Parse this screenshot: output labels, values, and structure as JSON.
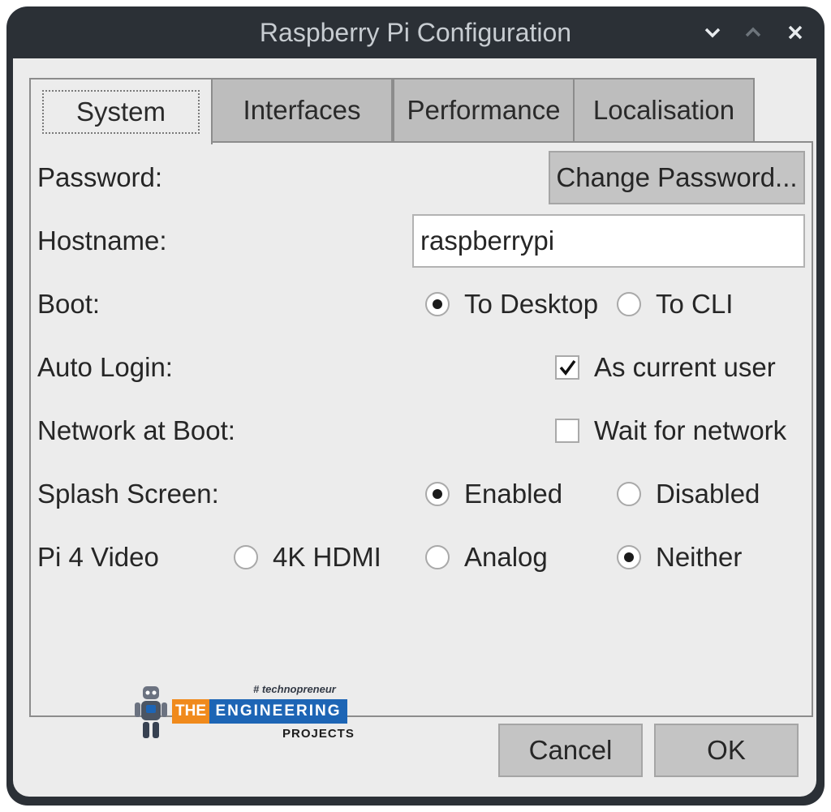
{
  "window": {
    "title": "Raspberry Pi Configuration"
  },
  "titlebar_icons": [
    "chevron-down-icon",
    "chevron-up-icon",
    "close-icon"
  ],
  "tabs": [
    {
      "label": "System",
      "active": true
    },
    {
      "label": "Interfaces",
      "active": false
    },
    {
      "label": "Performance",
      "active": false
    },
    {
      "label": "Localisation",
      "active": false
    }
  ],
  "system": {
    "password": {
      "label": "Password:",
      "button": "Change Password..."
    },
    "hostname": {
      "label": "Hostname:",
      "value": "raspberrypi"
    },
    "boot": {
      "label": "Boot:",
      "options": [
        "To Desktop",
        "To CLI"
      ],
      "selected": "To Desktop"
    },
    "auto_login": {
      "label": "Auto Login:",
      "option": "As current user",
      "checked": true
    },
    "network_at_boot": {
      "label": "Network at Boot:",
      "option": "Wait for network",
      "checked": false
    },
    "splash_screen": {
      "label": "Splash Screen:",
      "options": [
        "Enabled",
        "Disabled"
      ],
      "selected": "Enabled"
    },
    "pi4_video": {
      "label": "Pi 4 Video",
      "options": [
        "4K HDMI",
        "Analog",
        "Neither"
      ],
      "selected": "Neither"
    }
  },
  "watermark": {
    "tagline": "# technopreneur",
    "the": "THE",
    "engineering": "ENGINEERING",
    "projects": "PROJECTS"
  },
  "footer": {
    "cancel": "Cancel",
    "ok": "OK"
  },
  "colors": {
    "titlebar": "#2b3036",
    "client_bg": "#ececec",
    "tab_inactive": "#bdbdbd",
    "button_bg": "#c4c4c4",
    "logo_orange": "#f08a1c",
    "logo_blue": "#1d65b5"
  }
}
